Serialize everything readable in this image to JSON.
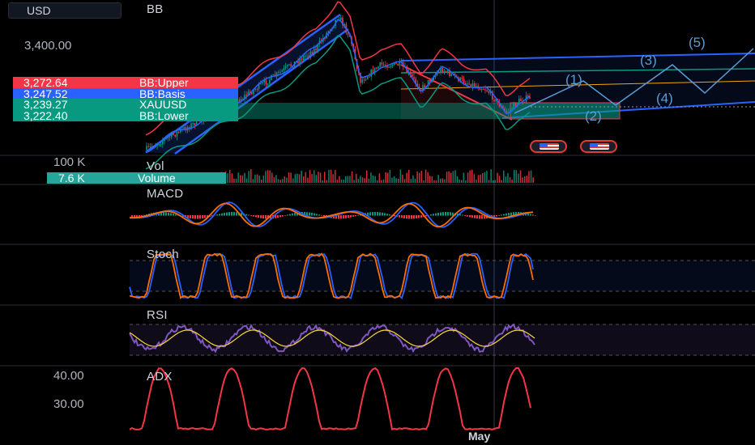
{
  "currency": "USD",
  "price_axis": {
    "label_3400": "3,400.00",
    "label_100k": "100 K",
    "adx_40": "40.00",
    "adx_30": "30.00"
  },
  "indicators": {
    "bb": "BB",
    "vol": "Vol",
    "macd": "MACD",
    "stoch": "Stoch",
    "rsi": "RSI",
    "adx": "ADX"
  },
  "tags": [
    {
      "value": "3,272.64",
      "name": "BB:Upper",
      "color": "#f23645"
    },
    {
      "value": "3,247.52",
      "name": "BB:Basis",
      "color": "#2962ff"
    },
    {
      "value": "3,239.27",
      "name": "XAUUSD",
      "color": "#089981"
    },
    {
      "value": "3,222.40",
      "name": "BB:Lower",
      "color": "#089981"
    }
  ],
  "volume_tag": {
    "value": "7.6 K",
    "name": "Volume",
    "color": "#26a69a"
  },
  "waves": [
    "(1)",
    "(2)",
    "(3)",
    "(4)",
    "(5)"
  ],
  "time_axis": {
    "month": "May"
  },
  "colors": {
    "up": "#089981",
    "down": "#f23645",
    "macd": "#2962ff",
    "signal": "#ff6d00",
    "rsi": "#7e57c2",
    "rsi_ma": "#fdd835",
    "adx": "#f23645"
  },
  "chart_data": {
    "type": "line",
    "title": "",
    "series": [
      {
        "name": "BB:Upper",
        "last": 3272.64
      },
      {
        "name": "BB:Basis",
        "last": 3247.52
      },
      {
        "name": "XAUUSD",
        "last": 3239.27
      },
      {
        "name": "BB:Lower",
        "last": 3222.4
      },
      {
        "name": "Volume",
        "last": 7600
      }
    ],
    "y_ticks": [
      3400.0
    ],
    "adx_ticks": [
      40.0,
      30.0
    ]
  }
}
